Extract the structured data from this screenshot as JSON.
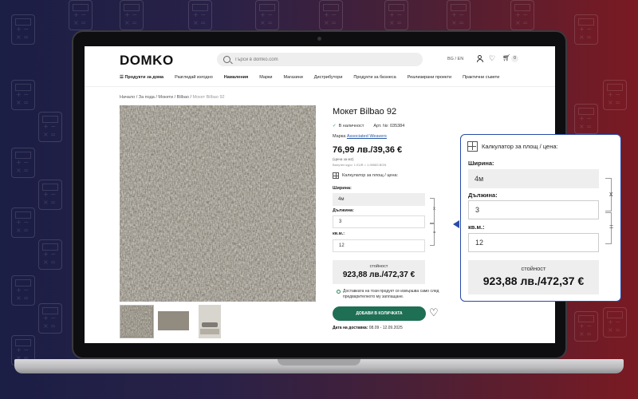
{
  "site": {
    "logo": "DOMKO",
    "search_placeholder": "Търси в domko.com",
    "lang": "BG / EN",
    "cart_count": "0"
  },
  "nav": {
    "items": [
      "☰ Продукти за дома",
      "Разгледай изгодно",
      "Намаления",
      "Марки",
      "Магазини",
      "Дистрибутори",
      "Продукти за бизнеса",
      "Реализирани проекти",
      "Практични съвети"
    ]
  },
  "breadcrumb": "Начало / За пода / Мокети / Bilbao /",
  "breadcrumb_current": "Мокет Bilbao 92",
  "product": {
    "title": "Мокет Bilbao 92",
    "availability": "В наличност",
    "article": "Арт. №: 035384",
    "brand_label": "Марка",
    "brand_name": "Associated Weavers",
    "price": "76,99 лв./39,36 €",
    "price_unit": "(Цена за м2)",
    "price_note": "Валутен курс: 1 EUR = 1.95583 BGN",
    "calc_link": "Калкулатор за площ / цена:",
    "add_to_cart": "ДОБАВИ В КОЛИЧКАТА",
    "delivery_note": "Доставката на този продукт се извършва само след предварителното му заплащане.",
    "delivery_label": "Дата на доставка:",
    "delivery_date": "08.09 - 12.09.2025"
  },
  "calculator": {
    "title": "Калкулатор за площ / цена:",
    "width_label": "Ширина:",
    "width_value": "4м",
    "length_label": "Дължина:",
    "length_value": "3",
    "area_label": "кв.м.:",
    "area_value": "12",
    "times": "x",
    "equals": "=",
    "total_label": "стойност",
    "total_value": "923,88 лв./472,37 €"
  }
}
